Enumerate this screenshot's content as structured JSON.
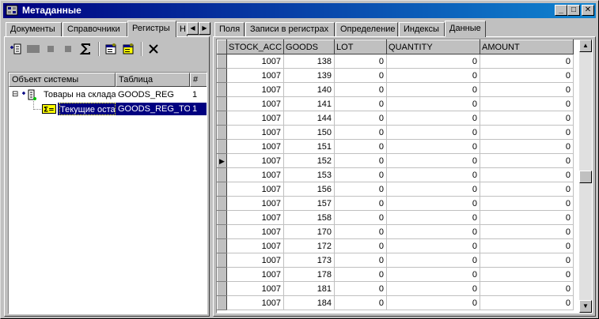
{
  "window": {
    "title": "Метаданные",
    "min_glyph": "_",
    "max_glyph": "□",
    "close_glyph": "✕"
  },
  "left": {
    "tabs": [
      "Документы",
      "Справочники",
      "Регистры",
      "Н"
    ],
    "active_tab": "Регистры",
    "tree_columns": [
      "Объект системы",
      "Таблица",
      "#"
    ],
    "tree_rows": [
      {
        "expander": "⊟",
        "name": "Товары на склада",
        "table": "GOODS_REG",
        "num": "1"
      },
      {
        "expander": "",
        "name": "Текущие остат",
        "table": "GOODS_REG_TO",
        "num": "1",
        "selected": true
      }
    ]
  },
  "right": {
    "tabs": [
      "Поля",
      "Записи в регистрах",
      "Определение",
      "Индексы",
      "Данные"
    ],
    "active_tab": "Данные",
    "columns": [
      "STOCK_ACC",
      "GOODS",
      "LOT",
      "QUANTITY",
      "AMOUNT"
    ],
    "current_row_index": 7,
    "rows": [
      [
        "1007",
        "138",
        "0",
        "0",
        "0"
      ],
      [
        "1007",
        "139",
        "0",
        "0",
        "0"
      ],
      [
        "1007",
        "140",
        "0",
        "0",
        "0"
      ],
      [
        "1007",
        "141",
        "0",
        "0",
        "0"
      ],
      [
        "1007",
        "144",
        "0",
        "0",
        "0"
      ],
      [
        "1007",
        "150",
        "0",
        "0",
        "0"
      ],
      [
        "1007",
        "151",
        "0",
        "0",
        "0"
      ],
      [
        "1007",
        "152",
        "0",
        "0",
        "0"
      ],
      [
        "1007",
        "153",
        "0",
        "0",
        "0"
      ],
      [
        "1007",
        "156",
        "0",
        "0",
        "0"
      ],
      [
        "1007",
        "157",
        "0",
        "0",
        "0"
      ],
      [
        "1007",
        "158",
        "0",
        "0",
        "0"
      ],
      [
        "1007",
        "170",
        "0",
        "0",
        "0"
      ],
      [
        "1007",
        "172",
        "0",
        "0",
        "0"
      ],
      [
        "1007",
        "173",
        "0",
        "0",
        "0"
      ],
      [
        "1007",
        "178",
        "0",
        "0",
        "0"
      ],
      [
        "1007",
        "181",
        "0",
        "0",
        "0"
      ],
      [
        "1007",
        "184",
        "0",
        "0",
        "0"
      ]
    ]
  },
  "colors": {
    "title_start": "#000080",
    "title_end": "#1084d0",
    "face": "#c0c0c0",
    "selection": "#000080"
  }
}
